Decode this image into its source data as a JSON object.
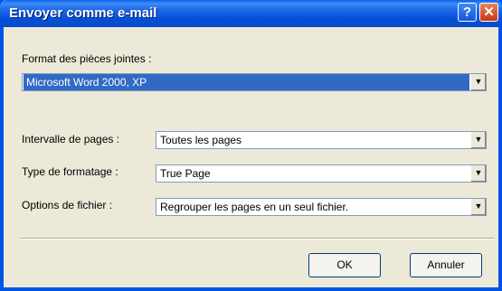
{
  "window": {
    "title": "Envoyer comme e-mail"
  },
  "titlebar_buttons": {
    "help": "?",
    "close": "✕"
  },
  "format": {
    "label": "Format des pièces jointes :",
    "value": "Microsoft Word 2000, XP"
  },
  "fields": [
    {
      "label": "Intervalle de pages :",
      "value": "Toutes les pages"
    },
    {
      "label": "Type de formatage :",
      "value": "True Page"
    },
    {
      "label": "Options de fichier :",
      "value": "Regrouper les pages en un seul fichier."
    }
  ],
  "buttons": {
    "ok": "OK",
    "cancel": "Annuler"
  },
  "icons": {
    "dropdown": "▼"
  },
  "colors": {
    "titlebar": "#0054e3",
    "selection": "#316ac5",
    "face": "#ece9d8"
  }
}
